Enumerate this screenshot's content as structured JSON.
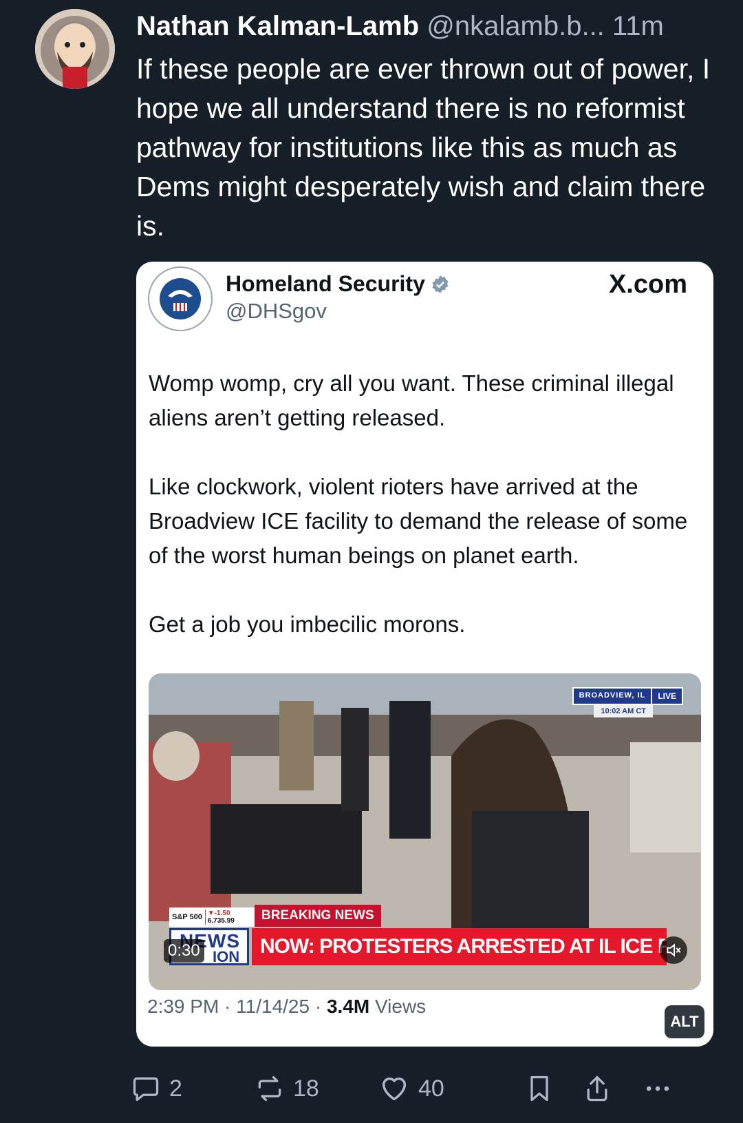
{
  "post": {
    "author_name": "Nathan Kalman-Lamb",
    "author_handle": "@nkalamb.b...",
    "time": "11m",
    "text": "If these people are ever thrown out of power, I hope we all understand there is no reformist pathway for institutions like this as much as Dems might desperately wish and claim there is."
  },
  "embed": {
    "name": "Homeland Security",
    "handle": "@DHSgov",
    "source": "X.com",
    "paragraphs": [
      "Womp womp, cry all you want. These criminal illegal aliens aren’t getting released.",
      "Like clockwork, violent rioters have arrived at the Broadview ICE facility to demand the release of some of the worst human beings on planet earth.",
      "Get a job you imbecilic morons."
    ],
    "video": {
      "location": "BROADVIEW, IL",
      "live_label": "LIVE",
      "clock": "10:02 AM CT",
      "ticker_name": "S&P 500",
      "ticker_change": "▼-1.50",
      "ticker_value": "6,735.99",
      "breaking_label": "BREAKING NEWS",
      "logo_line1": "NEWS",
      "logo_line2": "ION",
      "headline": "NOW: PROTESTERS ARRESTED AT IL ICE FACILITY",
      "duration": "0:30"
    },
    "meta_time": "2:39 PM · 11/14/25 · ",
    "meta_views_count": "3.4M",
    "meta_views_label": " Views"
  },
  "alt_label": "ALT",
  "actions": {
    "replies": "2",
    "reposts": "18",
    "likes": "40"
  },
  "colors": {
    "background": "#161e28",
    "breaking_red": "#e4172b",
    "news_blue": "#1f3a8a",
    "verified_grey": "#829aab"
  }
}
